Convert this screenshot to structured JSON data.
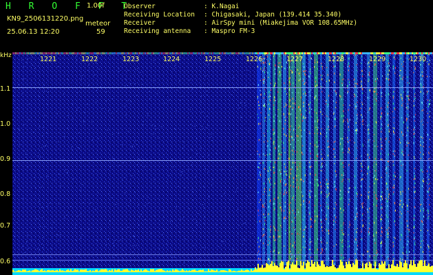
{
  "header": {
    "logo": "H R O F F T",
    "version": "1.00f",
    "filename": "KN9_2506131220.png",
    "meteor_label": "meteor",
    "datetime": "25.06.13 12:20",
    "meteor_count": "59",
    "info": [
      {
        "key": "Observer",
        "value": ": K.Nagai"
      },
      {
        "key": "Receiving Location",
        "value": ": Chigasaki, Japan (139.414 35.340)"
      },
      {
        "key": "Receiver",
        "value": ": AirSpy mini (Miakejima VOR 108.65MHz)"
      },
      {
        "key": "Receiving antenna",
        "value": ": Maspro FM-3"
      }
    ]
  },
  "spectrogram": {
    "y_unit": "kHz",
    "y_ticks": [
      "1.1",
      "1.0",
      "0.9",
      "0.8",
      "0.7",
      "0.6"
    ],
    "minute_ticks": [
      "1221",
      "1222",
      "1223",
      "1224",
      "1225",
      "1226",
      "1227",
      "1228",
      "1229",
      "1230"
    ]
  }
}
